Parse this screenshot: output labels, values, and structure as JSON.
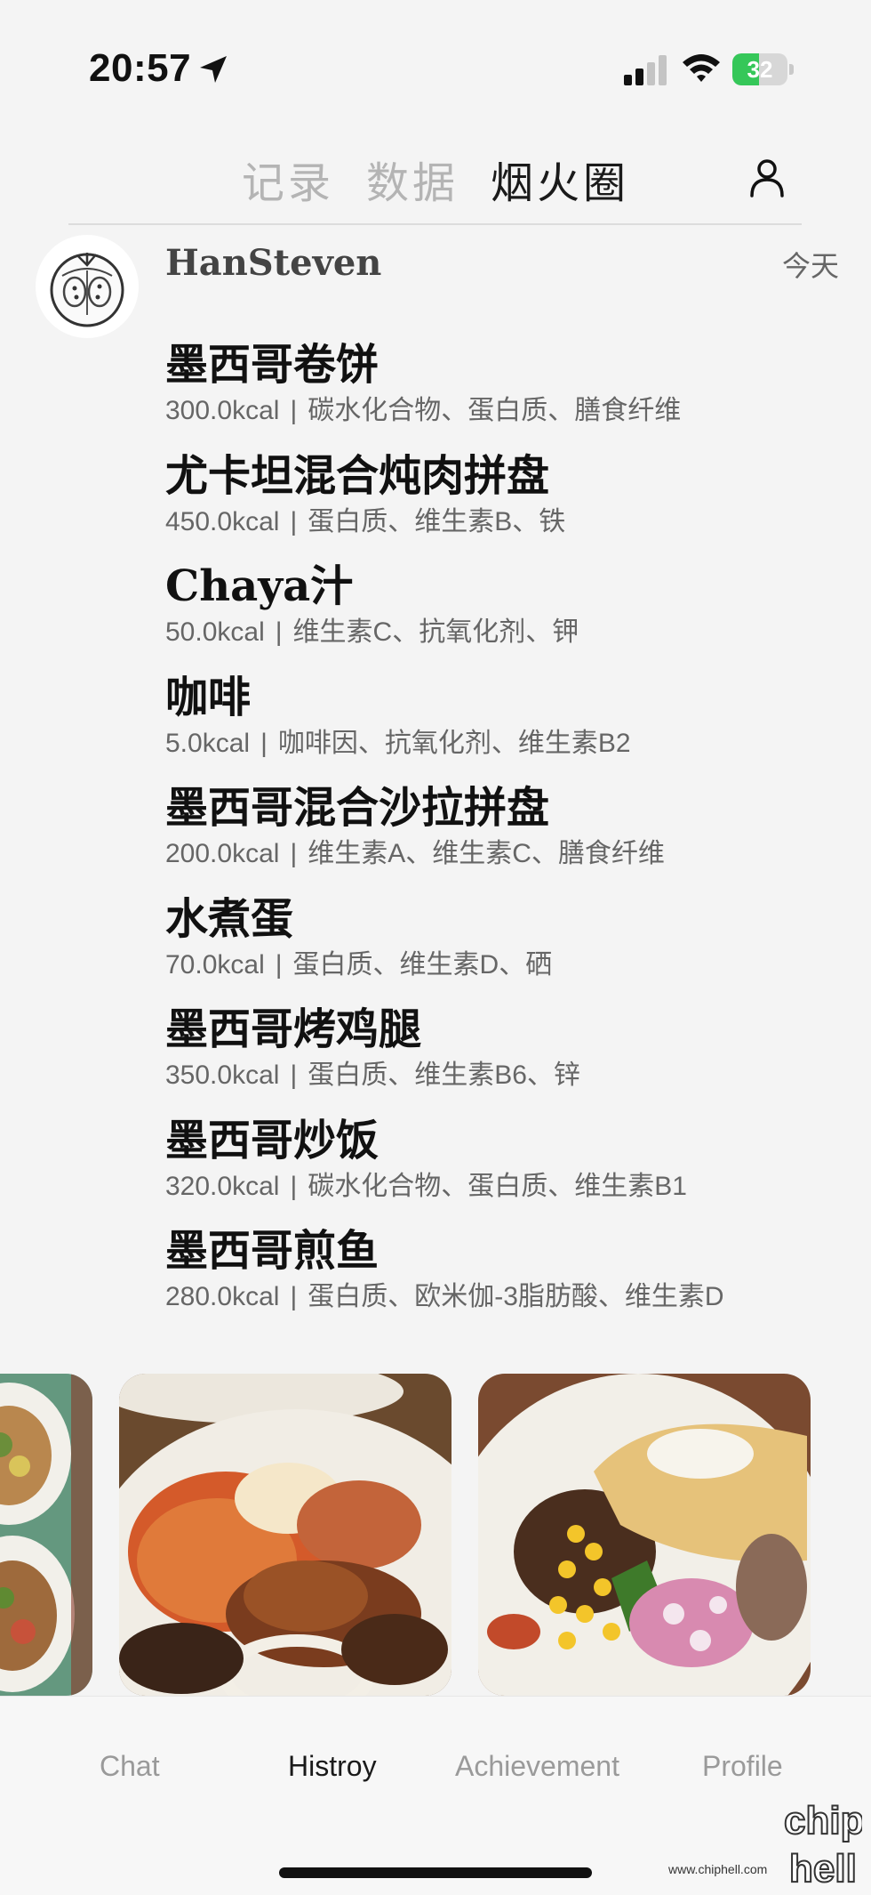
{
  "status_bar": {
    "time": "20:57",
    "battery_text": "32",
    "battery_level": 0.32,
    "colors": {
      "battery_fill": "#35c759"
    }
  },
  "top_nav": {
    "tabs": [
      {
        "label": "记录",
        "active": false
      },
      {
        "label": "数据",
        "active": false
      },
      {
        "label": "烟火圈",
        "active": true
      }
    ],
    "profile_icon": "person-icon"
  },
  "post": {
    "username": "HanSteven",
    "time": "今天",
    "items": [
      {
        "name": "墨西哥卷饼",
        "kcal": "300.0kcal",
        "separator": "|",
        "nutrients": "碳水化合物、蛋白质、膳食纤维"
      },
      {
        "name": "尤卡坦混合炖肉拼盘",
        "kcal": "450.0kcal",
        "separator": "|",
        "nutrients": "蛋白质、维生素B、铁"
      },
      {
        "name": "Chaya汁",
        "kcal": "50.0kcal",
        "separator": "|",
        "nutrients": "维生素C、抗氧化剂、钾"
      },
      {
        "name": "咖啡",
        "kcal": "5.0kcal",
        "separator": "|",
        "nutrients": "咖啡因、抗氧化剂、维生素B2"
      },
      {
        "name": "墨西哥混合沙拉拼盘",
        "kcal": "200.0kcal",
        "separator": "|",
        "nutrients": "维生素A、维生素C、膳食纤维"
      },
      {
        "name": "水煮蛋",
        "kcal": "70.0kcal",
        "separator": "|",
        "nutrients": "蛋白质、维生素D、硒"
      },
      {
        "name": "墨西哥烤鸡腿",
        "kcal": "350.0kcal",
        "separator": "|",
        "nutrients": "蛋白质、维生素B6、锌"
      },
      {
        "name": "墨西哥炒饭",
        "kcal": "320.0kcal",
        "separator": "|",
        "nutrients": "碳水化合物、蛋白质、维生素B1"
      },
      {
        "name": "墨西哥煎鱼",
        "kcal": "280.0kcal",
        "separator": "|",
        "nutrients": "蛋白质、欧米伽-3脂肪酸、维生素D"
      }
    ],
    "photos": [
      "food-photo-1",
      "food-photo-2",
      "food-photo-3"
    ]
  },
  "bottom_nav": {
    "items": [
      {
        "label": "Chat",
        "active": false
      },
      {
        "label": "Histroy",
        "active": true
      },
      {
        "label": "Achievement",
        "active": false
      },
      {
        "label": "Profile",
        "active": false
      }
    ]
  },
  "watermark": {
    "text": "www.chiphell.com",
    "logo_text": "chip hell"
  }
}
